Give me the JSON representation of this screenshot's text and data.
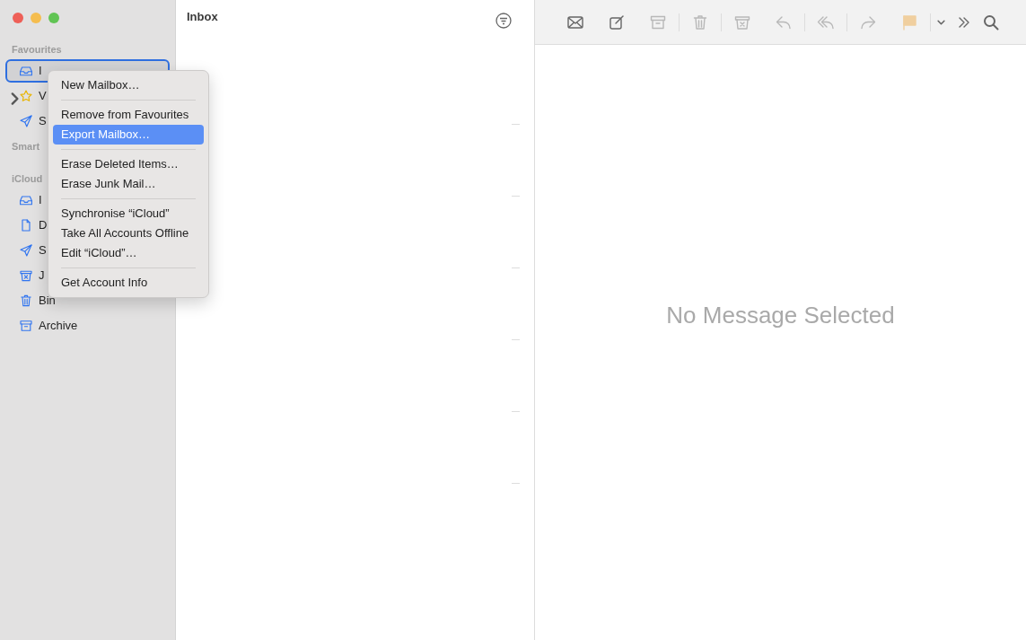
{
  "sidebar": {
    "sections": [
      {
        "header": "Favourites",
        "items": [
          {
            "label": "I",
            "kind": "inbox",
            "focused": true,
            "expandable": false
          },
          {
            "label": "V",
            "kind": "star",
            "focused": false,
            "expandable": true
          },
          {
            "label": "S",
            "kind": "send",
            "focused": false,
            "expandable": false
          }
        ]
      },
      {
        "header": "Smart"
      },
      {
        "header": "iCloud",
        "items": [
          {
            "label": "I",
            "kind": "inbox",
            "focused": false,
            "expandable": false
          },
          {
            "label": "D",
            "kind": "doc",
            "focused": false,
            "expandable": false
          },
          {
            "label": "S",
            "kind": "send",
            "focused": false,
            "expandable": false
          },
          {
            "label": "J",
            "kind": "junk",
            "focused": false,
            "expandable": false
          },
          {
            "label": "Bin",
            "kind": "trash",
            "focused": false,
            "expandable": false
          },
          {
            "label": "Archive",
            "kind": "archive",
            "focused": false,
            "expandable": false
          }
        ]
      }
    ]
  },
  "context_menu": [
    {
      "kind": "item",
      "label": "New Mailbox…",
      "selected": false
    },
    {
      "kind": "separator"
    },
    {
      "kind": "item",
      "label": "Remove from Favourites",
      "selected": false
    },
    {
      "kind": "item",
      "label": "Export Mailbox…",
      "selected": true
    },
    {
      "kind": "separator"
    },
    {
      "kind": "item",
      "label": "Erase Deleted Items…",
      "selected": false
    },
    {
      "kind": "item",
      "label": "Erase Junk Mail…",
      "selected": false
    },
    {
      "kind": "separator"
    },
    {
      "kind": "item",
      "label": "Synchronise “iCloud”",
      "selected": false
    },
    {
      "kind": "item",
      "label": "Take All Accounts Offline",
      "selected": false
    },
    {
      "kind": "item",
      "label": "Edit “iCloud”…",
      "selected": false
    },
    {
      "kind": "separator"
    },
    {
      "kind": "item",
      "label": "Get Account Info",
      "selected": false
    }
  ],
  "message_list": {
    "title": "Inbox"
  },
  "toolbar": [
    {
      "kind": "mail",
      "disabled": false
    },
    {
      "kind": "compose",
      "disabled": false
    },
    {
      "kind": "archive",
      "disabled": true
    },
    {
      "kind": "separator"
    },
    {
      "kind": "trash",
      "disabled": true
    },
    {
      "kind": "separator"
    },
    {
      "kind": "junk",
      "disabled": true
    },
    {
      "kind": "reply",
      "disabled": true
    },
    {
      "kind": "separator"
    },
    {
      "kind": "replyall",
      "disabled": true
    },
    {
      "kind": "separator"
    },
    {
      "kind": "forward",
      "disabled": true
    },
    {
      "kind": "flag",
      "disabled": true
    },
    {
      "kind": "separator"
    },
    {
      "kind": "chevron",
      "disabled": false
    },
    {
      "kind": "more",
      "disabled": false
    },
    {
      "kind": "search",
      "disabled": false
    }
  ],
  "viewer": {
    "empty_text": "No Message Selected"
  }
}
